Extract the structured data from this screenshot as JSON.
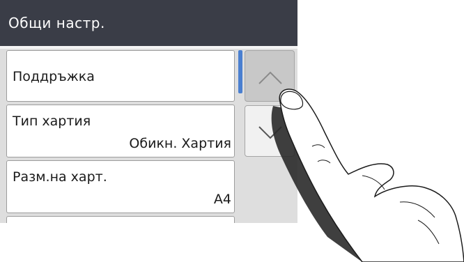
{
  "header": {
    "title": "Общи настр."
  },
  "menu": {
    "items": [
      {
        "label": "Поддръжка",
        "value": ""
      },
      {
        "label": "Тип хартия",
        "value": "Обикн. Хартия"
      },
      {
        "label": "Разм.на харт.",
        "value": "A4"
      }
    ]
  },
  "nav": {
    "up_icon": "chevron-up-icon",
    "down_icon": "chevron-down-icon"
  },
  "colors": {
    "title_bar": "#3a3d47",
    "scroll_thumb": "#4a7fd0",
    "screen_bg": "#dedede"
  }
}
